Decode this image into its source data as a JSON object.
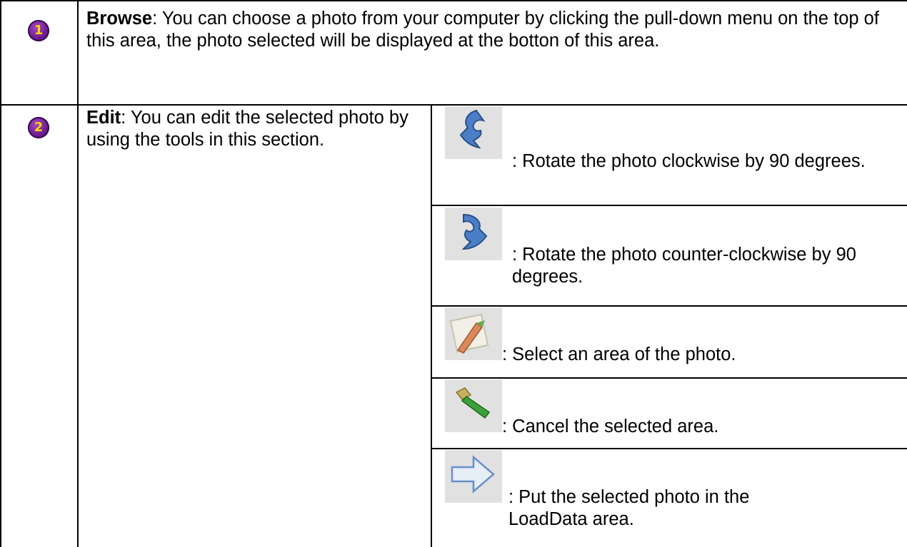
{
  "rows": [
    {
      "number": "1",
      "title": "Browse",
      "description": ": You can choose a photo from your computer by clicking the pull-down menu on the top of this area, the photo selected will be displayed at the botton of this area."
    },
    {
      "number": "2",
      "title": "Edit",
      "description": ": You can edit the selected photo by using the tools in this section.",
      "tools": [
        {
          "icon": "rotate-clockwise-icon",
          "text": ": Rotate the photo clockwise by 90 degrees."
        },
        {
          "icon": "rotate-counterclockwise-icon",
          "text": ": Rotate the photo counter-clockwise by 90 degrees."
        },
        {
          "icon": "select-area-icon",
          "text": ": Select an area of the photo."
        },
        {
          "icon": "cancel-selection-icon",
          "text": ": Cancel the selected area."
        },
        {
          "icon": "put-in-loaddata-arrow-icon",
          "text": ": Put the selected photo in the LoadData area."
        }
      ]
    }
  ]
}
